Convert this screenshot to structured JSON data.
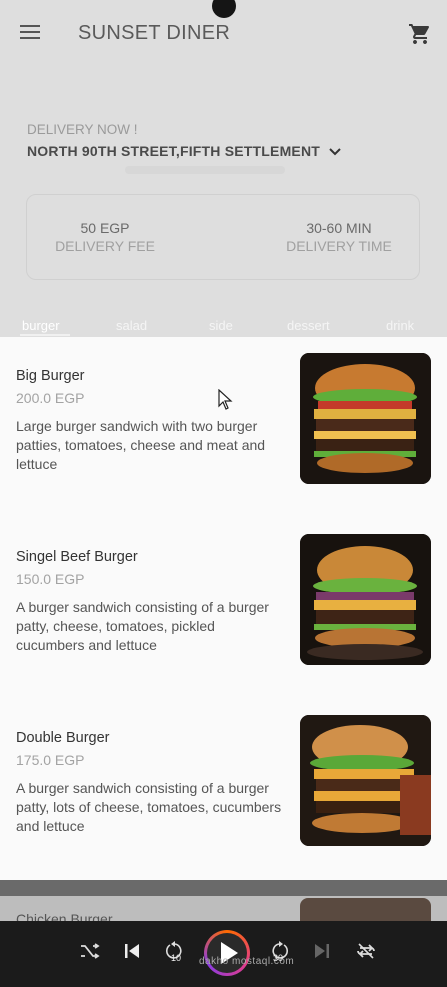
{
  "app": {
    "title": "SUNSET DINER"
  },
  "icons": {
    "menu": "menu-icon",
    "cart": "cart-icon",
    "chevron": "chevron-down-icon"
  },
  "delivery": {
    "label": "DELIVERY NOW !",
    "address": "NORTH 90TH STREET,FIFTH SETTLEMENT",
    "fee_value": "50 EGP",
    "fee_label": "DELIVERY FEE",
    "time_value": "30-60 MIN",
    "time_label": "DELIVERY TIME"
  },
  "tabs": [
    {
      "label": "burger",
      "active": true
    },
    {
      "label": "salad"
    },
    {
      "label": "side"
    },
    {
      "label": "dessert"
    },
    {
      "label": "drink"
    }
  ],
  "items": [
    {
      "name": "Big Burger",
      "price": "200.0 EGP",
      "description": "Large burger sandwich with two burger patties, tomatoes, cheese and meat and lettuce"
    },
    {
      "name": "Singel Beef Burger",
      "price": "150.0 EGP",
      "description": "A burger sandwich consisting of a burger patty, cheese, tomatoes, pickled cucumbers and lettuce"
    },
    {
      "name": "Double Burger",
      "price": "175.0 EGP",
      "description": "A burger sandwich consisting of a burger patty, lots of cheese, tomatoes, cucumbers and lettuce"
    }
  ],
  "peek_item": {
    "name": "Chicken Burger"
  },
  "player": {
    "watermark": "dakho mostaql.com",
    "rewind_label": "10",
    "forward_label": "30"
  }
}
